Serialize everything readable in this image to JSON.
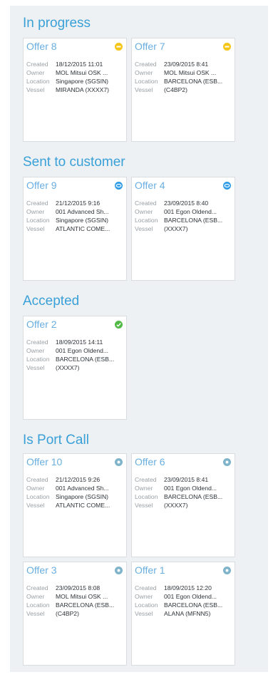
{
  "labels": {
    "created": "Created",
    "owner": "Owner",
    "location": "Location",
    "vessel": "Vessel"
  },
  "colors": {
    "accent": "#3aa0d8",
    "status_in_progress": "#f5c518",
    "status_sent": "#2e9be6",
    "status_accepted": "#52b947",
    "status_port_call": "#7fb3c9"
  },
  "sections": [
    {
      "title": "In progress",
      "cards": [
        {
          "title": "Offer 8",
          "status_icon": "in-progress-icon",
          "created": "18/12/2015 11:01",
          "owner": "MOL Mitsui OSK ...",
          "location": "Singapore (SGSIN)",
          "vessel": "MIRANDA (XXXX7)"
        },
        {
          "title": "Offer 7",
          "status_icon": "in-progress-icon",
          "created": "23/09/2015 8:41",
          "owner": "MOL Mitsui OSK ...",
          "location": "BARCELONA (ESB...",
          "vessel": "(C4BP2)"
        }
      ]
    },
    {
      "title": "Sent to customer",
      "cards": [
        {
          "title": "Offer 9",
          "status_icon": "sent-icon",
          "created": "21/12/2015 9:16",
          "owner": "001 Advanced Sh...",
          "location": "Singapore (SGSIN)",
          "vessel": "ATLANTIC COME..."
        },
        {
          "title": "Offer 4",
          "status_icon": "sent-icon",
          "created": "23/09/2015 8:40",
          "owner": "001 Egon Oldend...",
          "location": "BARCELONA (ESB...",
          "vessel": "(XXXX7)"
        }
      ]
    },
    {
      "title": "Accepted",
      "cards": [
        {
          "title": "Offer 2",
          "status_icon": "check-circle-icon",
          "created": "18/09/2015 14:11",
          "owner": "001 Egon Oldend...",
          "location": "BARCELONA (ESB...",
          "vessel": "(XXXX7)"
        }
      ]
    },
    {
      "title": "Is Port Call",
      "cards": [
        {
          "title": "Offer 10",
          "status_icon": "port-call-icon",
          "created": "21/12/2015 9:26",
          "owner": "001 Advanced Sh...",
          "location": "Singapore (SGSIN)",
          "vessel": "ATLANTIC COME..."
        },
        {
          "title": "Offer 6",
          "status_icon": "port-call-icon",
          "created": "23/09/2015 8:41",
          "owner": "001 Egon Oldend...",
          "location": "BARCELONA (ESB...",
          "vessel": "(XXXX7)"
        },
        {
          "title": "Offer 3",
          "status_icon": "port-call-icon",
          "created": "23/09/2015 8:08",
          "owner": "MOL Mitsui OSK ...",
          "location": "BARCELONA (ESB...",
          "vessel": "(C4BP2)"
        },
        {
          "title": "Offer 1",
          "status_icon": "port-call-icon",
          "created": "18/09/2015 12:20",
          "owner": "001 Egon Oldend...",
          "location": "BARCELONA (ESB...",
          "vessel": "ALANA (MFNN5)"
        }
      ]
    }
  ]
}
